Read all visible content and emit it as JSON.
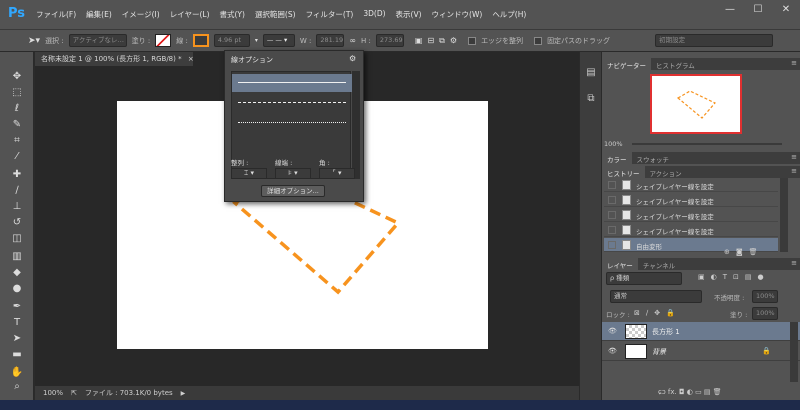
{
  "app": {
    "logo": "Ps"
  },
  "menu": [
    "ファイル(F)",
    "編集(E)",
    "イメージ(I)",
    "レイヤー(L)",
    "書式(Y)",
    "選択範囲(S)",
    "フィルター(T)",
    "3D(D)",
    "表示(V)",
    "ウィンドウ(W)",
    "ヘルプ(H)"
  ],
  "window_controls": {
    "minimize": "—",
    "maximize": "☐",
    "close": "✕"
  },
  "options_bar": {
    "select_label": "選択 :",
    "select_value": "アクティブなレ…",
    "fill_label": "塗り :",
    "stroke_label": "線 :",
    "stroke_width": "4.96 pt",
    "w_label": "W :",
    "w_value": "281.19",
    "h_label": "H :",
    "h_value": "273.69",
    "align_edges": "エッジを整列",
    "fix_path": "固定パスのドラッグ",
    "workspace": "初期設定",
    "stroke_color": "#f7931e"
  },
  "document": {
    "tab_title": "名称未設定 1 @ 100% (長方形 1, RGB/8) *",
    "tab_close": "×",
    "zoom": "100%",
    "file_info": "ファイル : 703.1K/0 bytes",
    "shape_stroke_color": "#f7931e"
  },
  "stroke_popup": {
    "title": "線オプション",
    "settings_icon": "⚙",
    "align_label": "整列 :",
    "caps_label": "線端 :",
    "corners_label": "角 :",
    "advanced_button": "詳細オプション..."
  },
  "navigator": {
    "tabs": [
      "ナビゲーター",
      "ヒストグラム"
    ],
    "zoom": "100%"
  },
  "color_panel": {
    "tabs": [
      "カラー",
      "スウォッチ"
    ]
  },
  "history_panel": {
    "tabs": [
      "ヒストリー",
      "アクション"
    ],
    "items": [
      "シェイプレイヤー線を設定",
      "シェイプレイヤー線を設定",
      "シェイプレイヤー線を設定",
      "シェイプレイヤー線を設定",
      "自由変形"
    ]
  },
  "layers_panel": {
    "tabs": [
      "レイヤー",
      "チャンネル"
    ],
    "filter_label": "ρ 種類",
    "blend_mode": "通常",
    "opacity_label": "不透明度 :",
    "opacity_value": "100%",
    "lock_label": "ロック :",
    "fill_label": "塗り :",
    "fill_value": "100%",
    "layers": [
      "長方形 1",
      "背景"
    ],
    "bottom_icons": "ɕɔ  fx.  ◘  ◐  ▭  ▤  🗑"
  }
}
